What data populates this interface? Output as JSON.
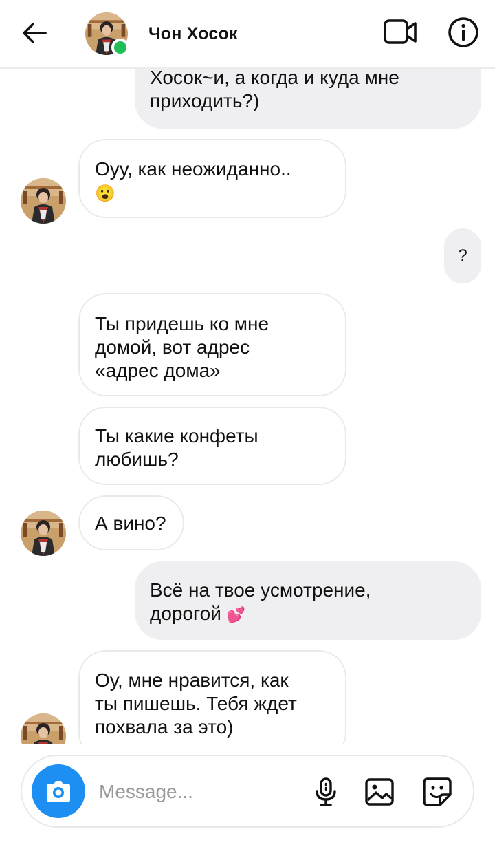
{
  "header": {
    "contact_name": "Чон Хосок",
    "online_color": "#1fbf57",
    "icons": [
      "back-arrow-icon",
      "video-call-icon",
      "info-icon"
    ]
  },
  "messages": [
    {
      "direction": "outgoing",
      "text": "Хосок~и, а когда и куда мне\nприходить?)"
    },
    {
      "direction": "incoming",
      "text": "Оуу,  как неожиданно..",
      "emoji": "😮"
    },
    {
      "direction": "outgoing",
      "text": "?"
    },
    {
      "direction": "incoming",
      "text": "Ты придешь ко мне\nдомой,  вот адрес\n«адрес дома»"
    },
    {
      "direction": "incoming",
      "text": "Ты какие конфеты\nлюбишь?"
    },
    {
      "direction": "incoming",
      "text": "А вино?"
    },
    {
      "direction": "outgoing",
      "text": "Всё на твое усмотрение,\nдорогой",
      "emoji": "💕"
    },
    {
      "direction": "incoming",
      "text": "Оу,  мне нравится,  как\nты пишешь. Тебя ждет\nпохвала за это)"
    }
  ],
  "composer": {
    "placeholder": "Message...",
    "accent_color": "#1d8ef2",
    "icons": [
      "camera-icon",
      "microphone-icon",
      "gallery-icon",
      "sticker-icon"
    ]
  }
}
